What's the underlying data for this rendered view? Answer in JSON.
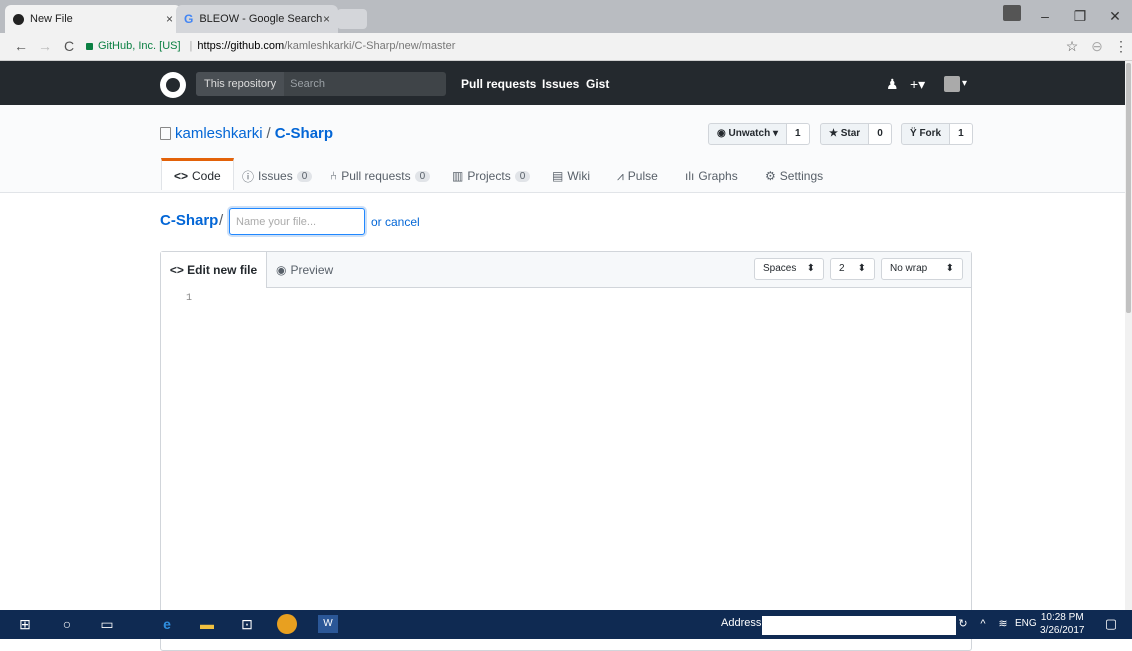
{
  "browser": {
    "tabs": [
      {
        "title": "New File",
        "close": "×"
      },
      {
        "title": "BLEOW - Google Search",
        "close": "×"
      }
    ],
    "window_controls": {
      "minimize": "–",
      "maximize": "❐",
      "close": "✕"
    },
    "address": {
      "security_label": "GitHub, Inc. [US]",
      "url_host": "https://github.com",
      "url_path": "/kamleshkarki/C-Sharp/new/master"
    }
  },
  "gh_header": {
    "search_scope": "This repository",
    "search_placeholder": "Search",
    "nav": [
      "Pull requests",
      "Issues",
      "Gist"
    ]
  },
  "repo": {
    "owner": "kamleshkarki",
    "name": "C-Sharp",
    "watch": {
      "label": "Unwatch ▾",
      "count": "1"
    },
    "star": {
      "label": "Star",
      "count": "0"
    },
    "fork": {
      "label": "Fork",
      "count": "1"
    },
    "tabs": [
      {
        "label": "Code",
        "count": ""
      },
      {
        "label": "Issues",
        "count": "0"
      },
      {
        "label": "Pull requests",
        "count": "0"
      },
      {
        "label": "Projects",
        "count": "0"
      },
      {
        "label": "Wiki",
        "count": ""
      },
      {
        "label": "Pulse",
        "count": ""
      },
      {
        "label": "Graphs",
        "count": ""
      },
      {
        "label": "Settings",
        "count": ""
      }
    ]
  },
  "new_file": {
    "breadcrumb_repo": "C-Sharp",
    "breadcrumb_sep": "/",
    "filename_placeholder": "Name your file...",
    "cancel_text": "or cancel"
  },
  "editor": {
    "tab_edit": "Edit new file",
    "tab_preview": "Preview",
    "indent_mode": "Spaces",
    "indent_size": "2",
    "wrap_mode": "No wrap",
    "line_number": "1"
  },
  "taskbar": {
    "address_label": "Address",
    "lang": "ENG",
    "time": "10:28 PM",
    "date": "3/26/2017"
  }
}
